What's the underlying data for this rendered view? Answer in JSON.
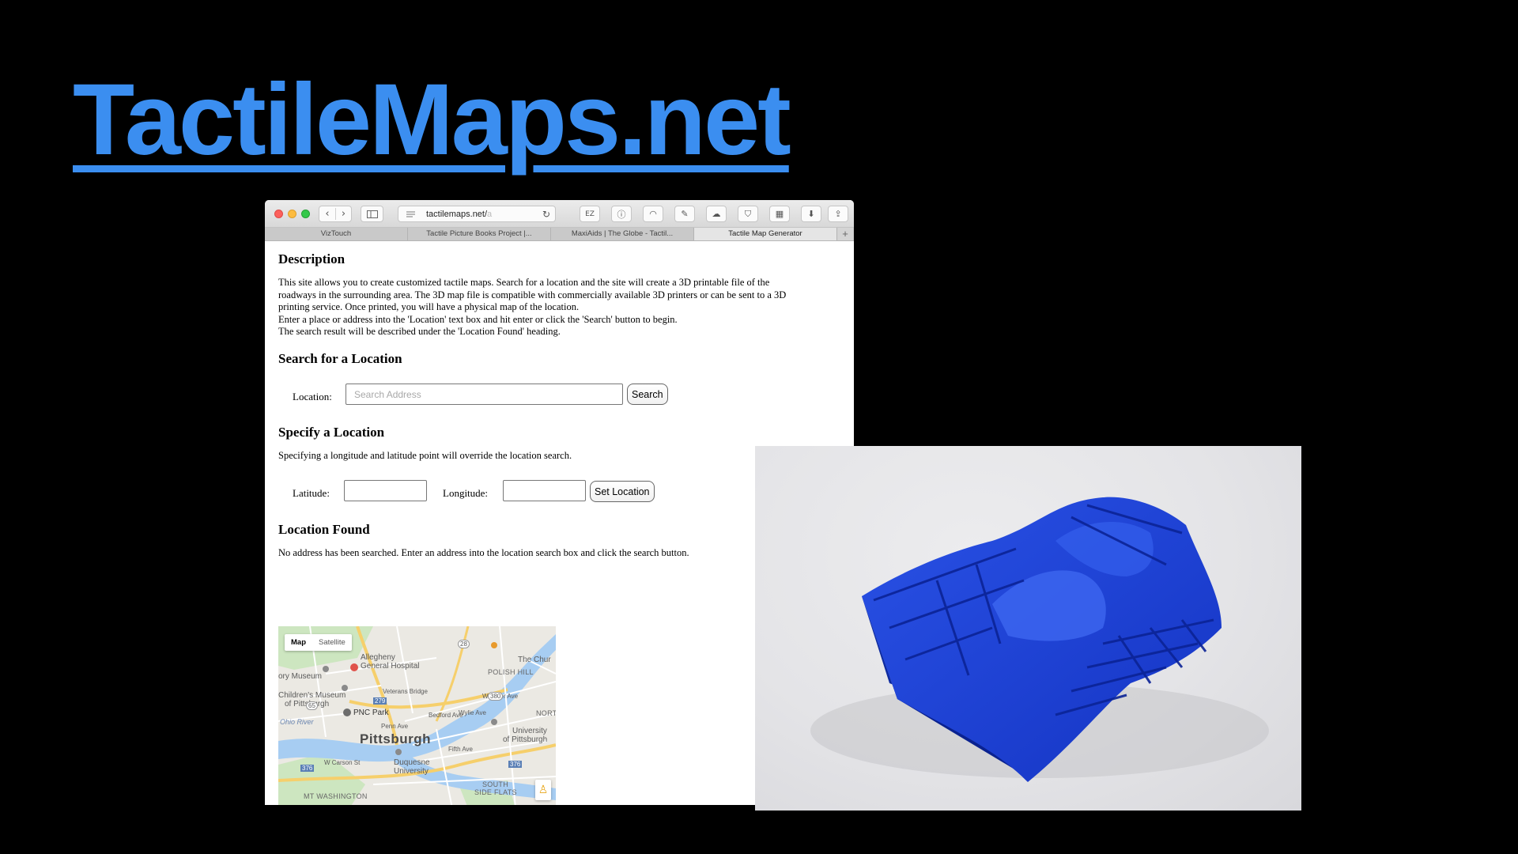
{
  "slide": {
    "title": "TactileMaps.net"
  },
  "browser": {
    "url_visible": "tactilemaps.net/",
    "url_faded": "a",
    "ext_ez": "EZ",
    "tabs": [
      {
        "label": "VizTouch",
        "active": false
      },
      {
        "label": "Tactile Picture Books Project |...",
        "active": false
      },
      {
        "label": "MaxiAids | The Globe - Tactil...",
        "active": false
      },
      {
        "label": "Tactile Map Generator",
        "active": true
      }
    ],
    "new_tab_label": "+"
  },
  "page": {
    "description_heading": "Description",
    "description_lines": [
      "This site allows you to create customized tactile maps. Search for a location and the site will create a 3D printable file of the",
      "roadways in the surrounding area. The 3D map file is compatible with commercially available 3D printers or can be sent to a 3D",
      "printing service. Once printed, you will have a physical map of the location.",
      "Enter a place or address into the 'Location' text box and hit enter or click the 'Search' button to begin.",
      "The search result will be described under the 'Location Found' heading."
    ],
    "search_heading": "Search for a Location",
    "location_label": "Location:",
    "location_placeholder": "Search Address",
    "location_value": "",
    "search_button": "Search",
    "specify_heading": "Specify a Location",
    "specify_text": "Specifying a longitude and latitude point will override the location search.",
    "latitude_label": "Latitude:",
    "latitude_value": "",
    "longitude_label": "Longitude:",
    "longitude_value": "",
    "set_location_button": "Set Location",
    "found_heading": "Location Found",
    "found_text": "No address has been searched. Enter an address into the location search box and click the search button."
  },
  "map": {
    "toggle_map": "Map",
    "toggle_satellite": "Satellite",
    "labels": {
      "allegheny": "Allegheny",
      "general_hospital": "General Hospital",
      "ory_museum": "ory Museum",
      "childrens_museum": "Children's Museum",
      "of_pittsburgh": "of Pittsburgh",
      "pnc_park": "PNC Park",
      "pittsburgh": "Pittsburgh",
      "duquesne": "Duquesne",
      "university": "University",
      "polish_hill": "POLISH HILL",
      "the_church": "The Chur",
      "university_of": "University",
      "of_pittsburgh2": "of Pittsburgh",
      "south_side": "SOUTH",
      "side_flats": "SIDE FLATS",
      "mt_washington": "MT WASHINGTON",
      "ohio_river": "Ohio River",
      "nort": "NORT",
      "fifth_ave": "Fifth Ave",
      "penn_ave": "Penn Ave",
      "bedford_ave": "Bedford Ave",
      "wylie_ave": "Wylie Ave",
      "webster_ave": "Webster Ave",
      "veterans_bridge": "Veterans Bridge",
      "w_carson": "W Carson St",
      "r279": "279",
      "r376a": "376",
      "r376b": "376",
      "r28": "28",
      "r380": "380",
      "r65": "65"
    }
  },
  "colors": {
    "title_blue": "#3b8ef0",
    "print_blue": "#1a40d0",
    "background": "#000000"
  }
}
